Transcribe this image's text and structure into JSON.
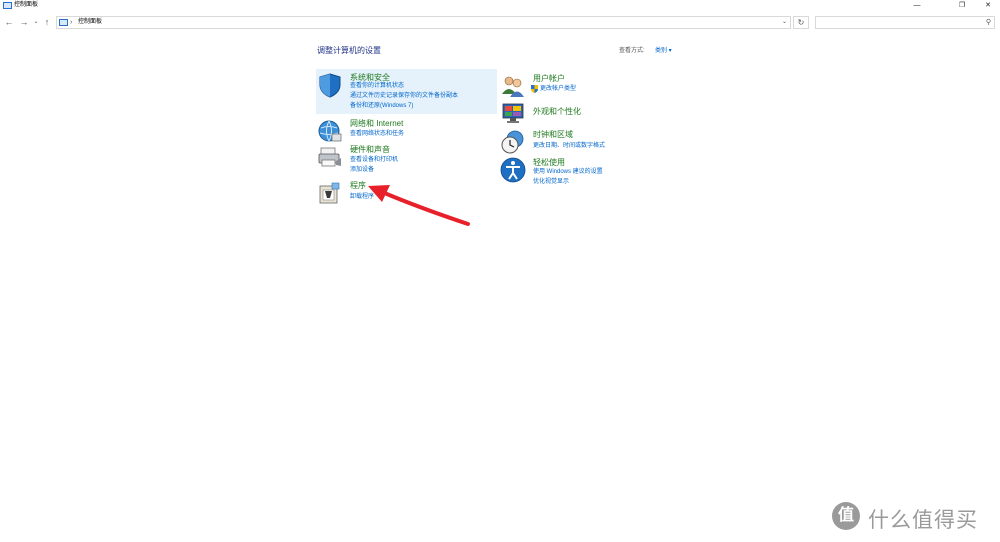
{
  "window": {
    "title": "控制面板",
    "buttons": {
      "minimize": "—",
      "restore": "❐",
      "close": "✕"
    }
  },
  "nav": {
    "back": "←",
    "forward": "→",
    "recent": "⌄",
    "up": "↑",
    "separator": "›",
    "breadcrumb": "控制面板",
    "dropdown": "⌄",
    "refresh": "↻",
    "search_icon": "⚲",
    "search_placeholder": ""
  },
  "main": {
    "heading": "调整计算机的设置",
    "view_by_label": "查看方式:",
    "view_by_value": "类别 ▾"
  },
  "categories_left": [
    {
      "title": "系统和安全",
      "icon": "shield-icon",
      "links": [
        "查看你的计算机状态",
        "通过文件历史记录保存你的文件备份副本",
        "备份和还原(Windows 7)"
      ]
    },
    {
      "title": "网络和 Internet",
      "icon": "globe-network-icon",
      "links": [
        "查看网络状态和任务"
      ]
    },
    {
      "title": "硬件和声音",
      "icon": "printer-icon",
      "links": [
        "查看设备和打印机",
        "添加设备"
      ]
    },
    {
      "title": "程序",
      "icon": "programs-icon",
      "links": [
        "卸载程序"
      ]
    }
  ],
  "categories_right": [
    {
      "title": "用户帐户",
      "icon": "users-icon",
      "links": [
        "更改帐户类型"
      ]
    },
    {
      "title": "外观和个性化",
      "icon": "monitor-icon",
      "links": []
    },
    {
      "title": "时钟和区域",
      "icon": "clock-globe-icon",
      "links": [
        "更改日期、时间或数字格式"
      ]
    },
    {
      "title": "轻松使用",
      "icon": "accessibility-icon",
      "links": [
        "使用 Windows 建议的设置",
        "优化视觉显示"
      ]
    }
  ],
  "watermark": {
    "icon_char": "值",
    "text": "什么值得买"
  },
  "colors": {
    "accent": "#0066cc",
    "category_title": "#1e7a1e",
    "highlight": "#e5f1fb",
    "arrow": "#e8202a"
  }
}
